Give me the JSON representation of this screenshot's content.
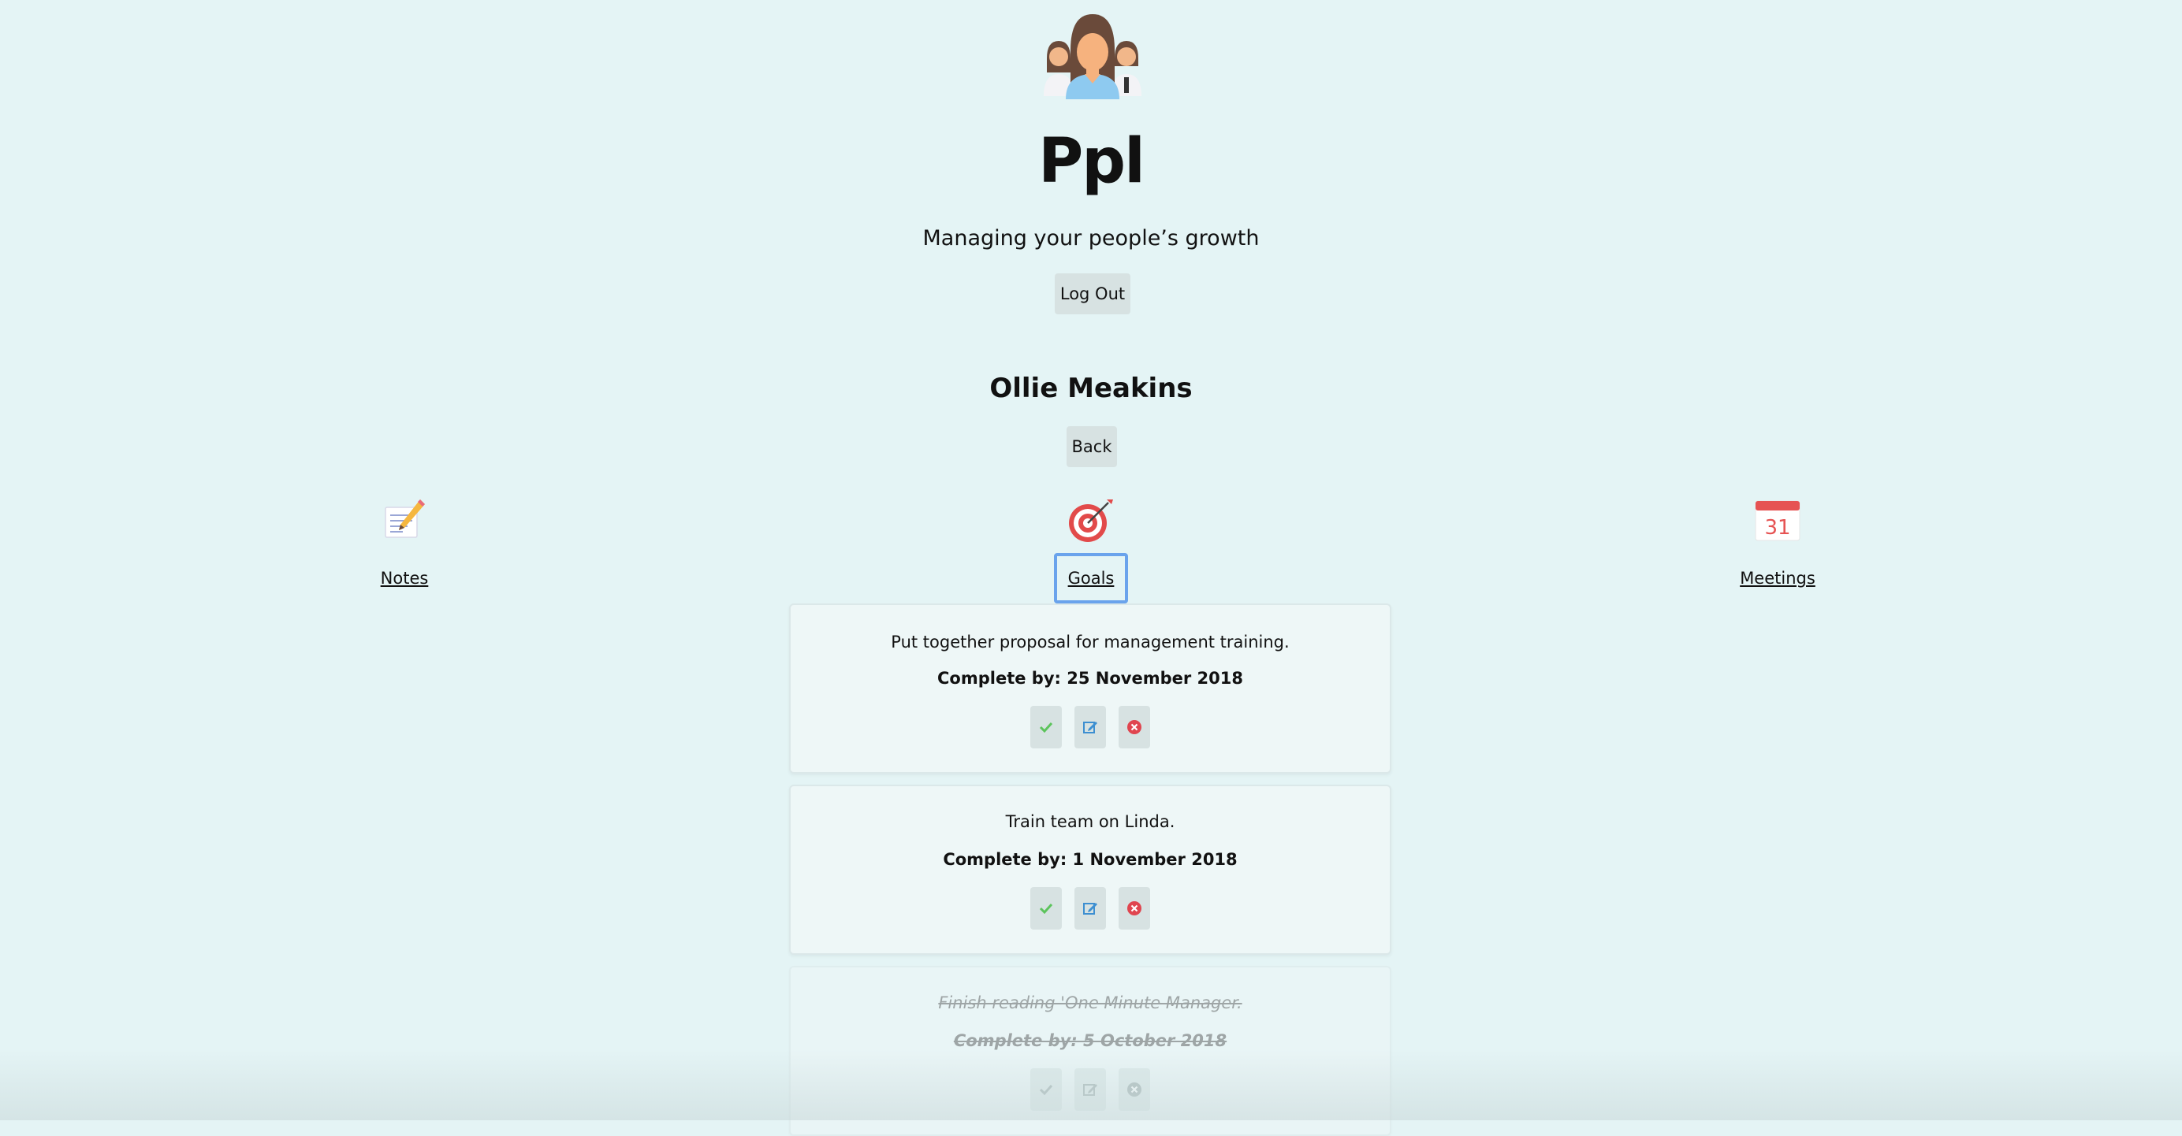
{
  "header": {
    "app_title": "Ppl",
    "tagline": "Managing your people’s growth",
    "logout_label": "Log Out"
  },
  "person": {
    "name": "Ollie Meakins",
    "back_label": "Back"
  },
  "nav": {
    "notes_label": "Notes",
    "goals_label": "Goals",
    "meetings_label": "Meetings",
    "calendar_day": "31",
    "active": "Goals"
  },
  "goals": [
    {
      "text": "Put together proposal for management training.",
      "date": "Complete by: 25 November 2018",
      "completed": false
    },
    {
      "text": "Train team on Linda.",
      "date": "Complete by: 1 November 2018",
      "completed": false
    },
    {
      "text": "Finish reading 'One Minute Manager.",
      "date": "Complete by: 5 October 2018",
      "completed": true
    }
  ],
  "icons": {
    "logo": "people-group-icon",
    "notes": "memo-icon",
    "goals": "target-icon",
    "meetings": "calendar-icon",
    "complete": "check-icon",
    "edit": "edit-icon",
    "delete": "delete-icon"
  },
  "colors": {
    "background": "#e4f4f5",
    "card": "#eef7f7",
    "button": "#d7e2e2",
    "check_green": "#5cc45c",
    "edit_blue": "#3d8fd1",
    "delete_red": "#e0454f",
    "focus_ring": "#6aa3ec"
  }
}
